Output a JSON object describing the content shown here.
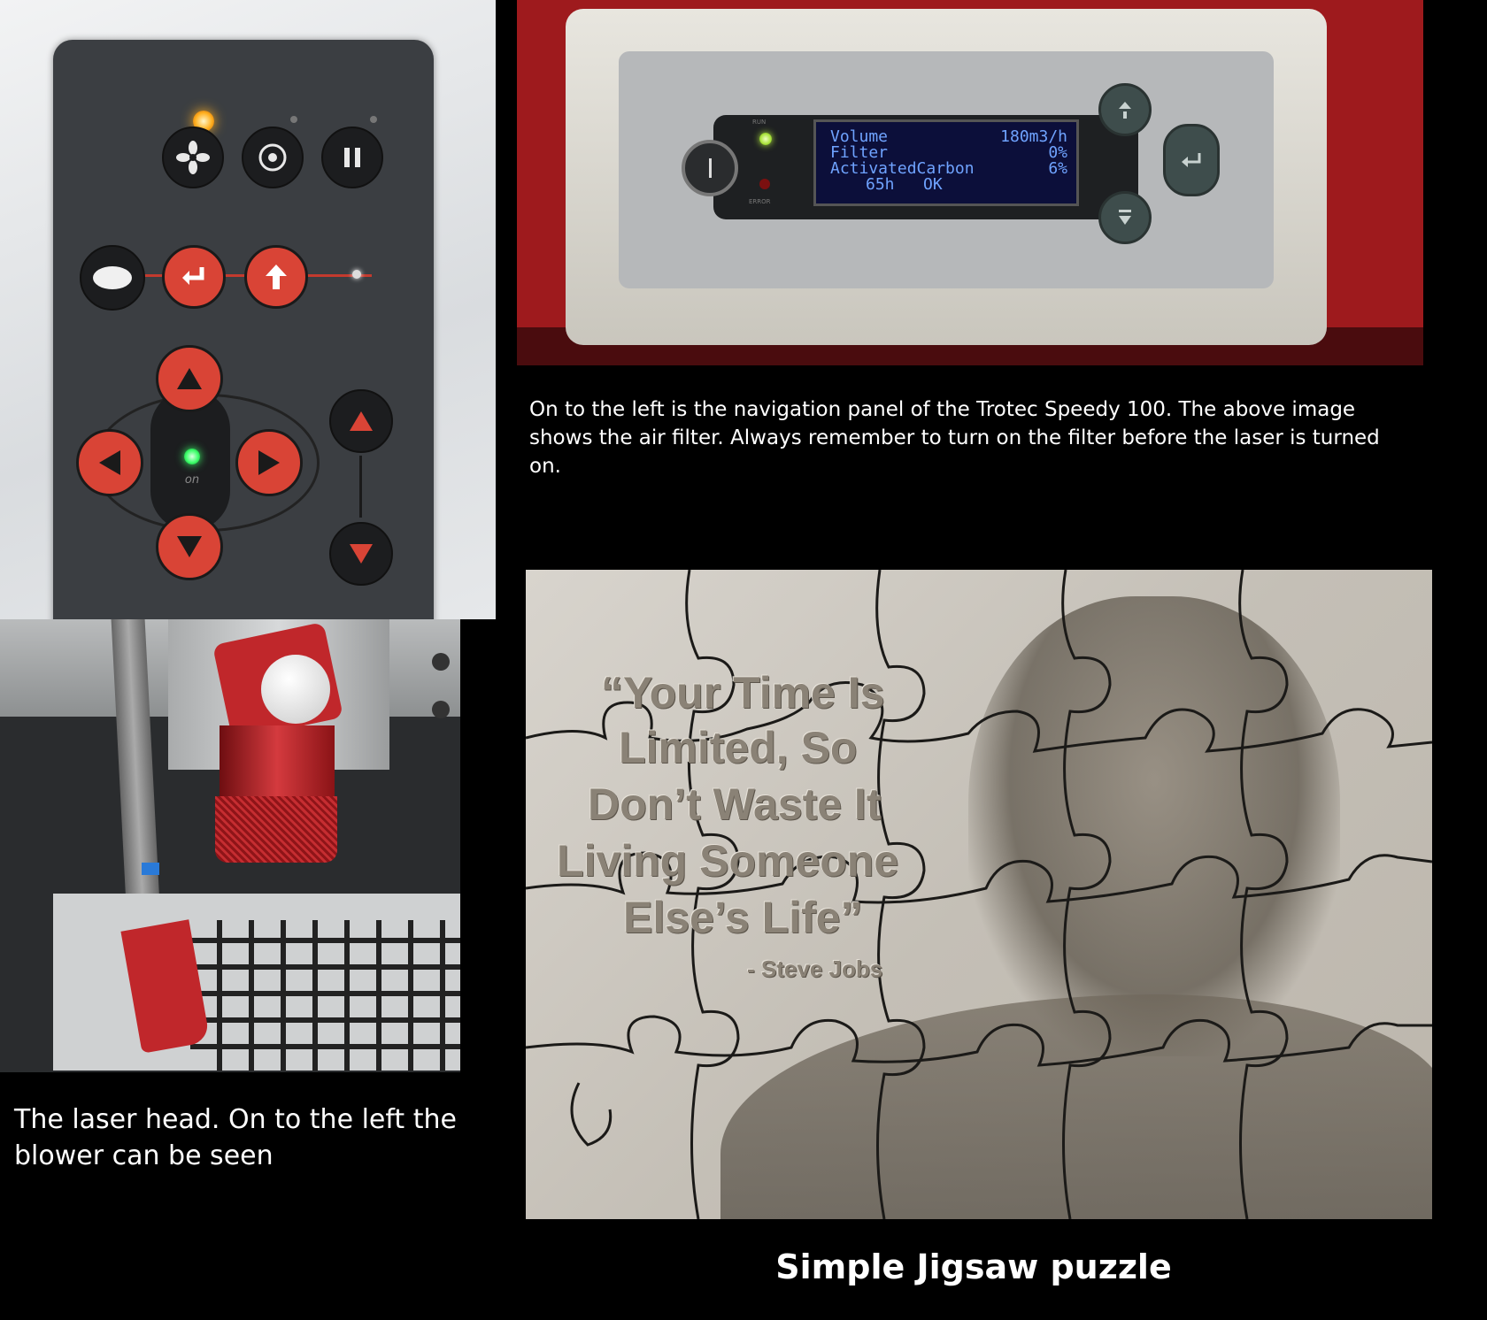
{
  "filter_display": {
    "line1_label": "Volume",
    "line1_value": "180m3/h",
    "line2_label": "Filter",
    "line2_value": "0%",
    "line3_label": "ActivatedCarbon",
    "line3_value": "6%",
    "line4": "65h   OK",
    "run_label": "RUN",
    "error_label": "ERROR"
  },
  "nav_panel": {
    "on_label": "on"
  },
  "puzzle": {
    "quote_lines": [
      "“Your Time Is",
      "Limited, So",
      "Don’t Waste It",
      "Living Someone",
      "Else’s Life”"
    ],
    "attribution": "- Steve Jobs"
  },
  "captions": {
    "filter": "On to the left is the navigation panel of the Trotec Speedy 100. The above image shows the air filter. Always remember to turn on the filter before the laser is turned on.",
    "laser_head": "The laser head. On to the left the blower can be seen",
    "puzzle": "Simple Jigsaw puzzle"
  },
  "colors": {
    "background": "#000000",
    "panel_red": "#d94436",
    "lcd_text": "#6fa3ff",
    "led_orange": "#ffb020",
    "led_green": "#3dff6a"
  },
  "icons": [
    "fan-icon",
    "target-icon",
    "pause-icon",
    "enter-icon",
    "up-arrow-icon",
    "arrow-up-icon",
    "arrow-down-icon",
    "arrow-left-icon",
    "arrow-right-icon",
    "enter-icon",
    "plus-icon",
    "minus-icon"
  ]
}
